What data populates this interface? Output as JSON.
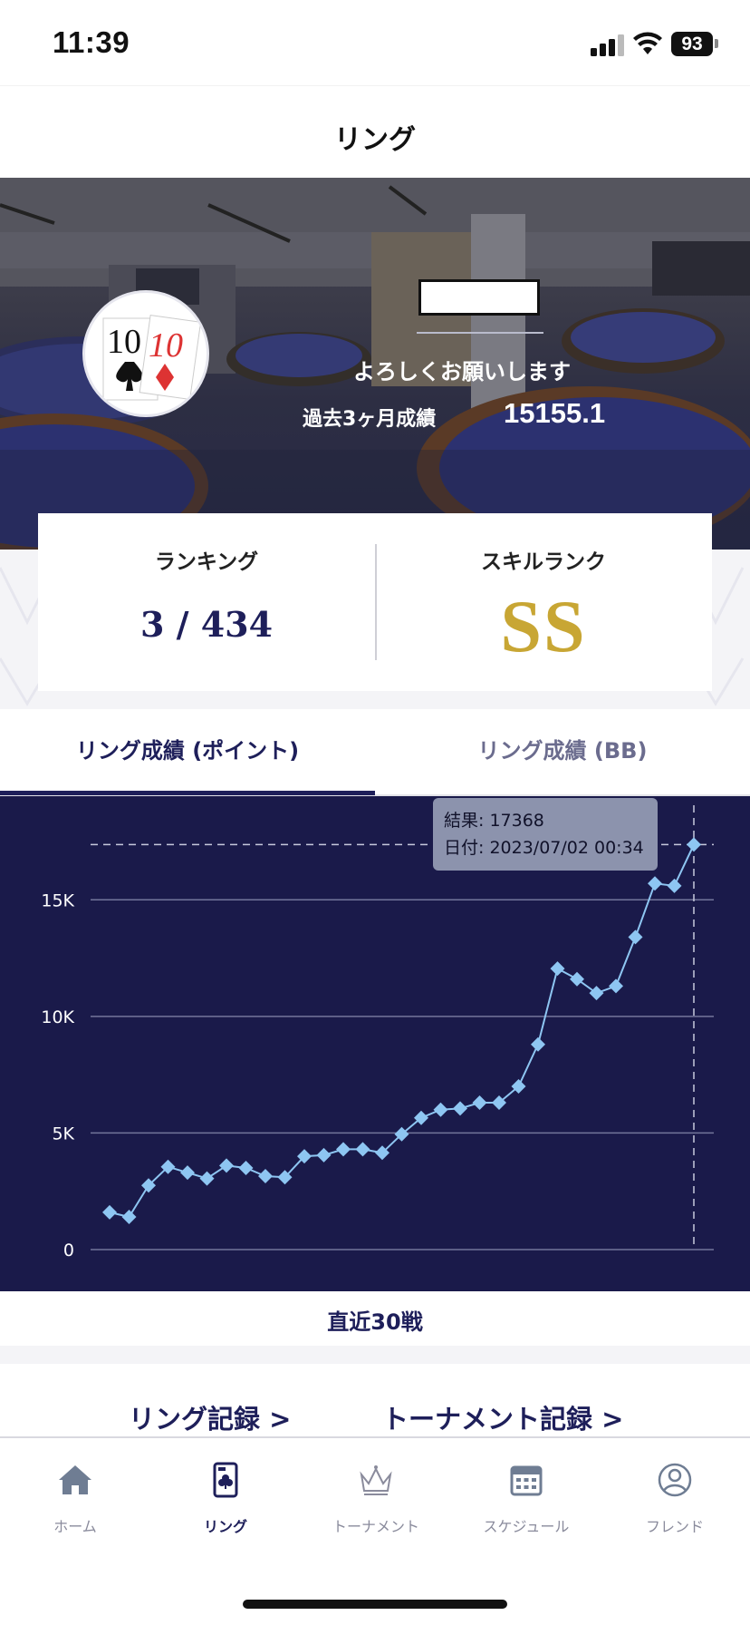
{
  "status_bar": {
    "time": "11:39",
    "battery": "93"
  },
  "header": {
    "title": "リング"
  },
  "profile": {
    "greeting": "よろしくお願いします",
    "record_label": "過去3ヶ月成績",
    "record_value": "15155.1"
  },
  "stats": {
    "ranking_label": "ランキング",
    "ranking_value": "3 / 434",
    "skill_label": "スキルランク",
    "skill_value": "SS"
  },
  "tabs": [
    {
      "label": "リング成績 (ポイント)",
      "active": true
    },
    {
      "label": "リング成績 (BB)",
      "active": false
    }
  ],
  "tooltip": {
    "result_label": "結果:",
    "result_value": "17368",
    "date_label": "日付:",
    "date_value": "2023/07/02 00:34"
  },
  "chart_data": {
    "type": "line",
    "y_ticks": [
      "0",
      "5K",
      "10K",
      "15K"
    ],
    "ylim": [
      0,
      17500
    ],
    "y_tick_values": [
      0,
      5000,
      10000,
      15000
    ],
    "x": [
      1,
      2,
      3,
      4,
      5,
      6,
      7,
      8,
      9,
      10,
      11,
      12,
      13,
      14,
      15,
      16,
      17,
      18,
      19,
      20,
      21,
      22,
      23,
      24,
      25,
      26,
      27,
      28,
      29,
      30
    ],
    "values": [
      1600,
      1400,
      2750,
      3550,
      3300,
      3050,
      3600,
      3500,
      3150,
      3100,
      4000,
      4050,
      4300,
      4300,
      4150,
      4950,
      5650,
      6000,
      6050,
      6300,
      6300,
      7000,
      8800,
      12050,
      11600,
      11000,
      11300,
      13400,
      15700,
      15600,
      17368
    ],
    "series": [
      {
        "values": [
          1600,
          1400,
          2750,
          3550,
          3300,
          3050,
          3600,
          3500,
          3150,
          3100,
          4000,
          4050,
          4300,
          4300,
          4150,
          4950,
          5650,
          6000,
          6050,
          6300,
          6300,
          7000,
          8800,
          12050,
          11600,
          11000,
          11300,
          13400,
          15700,
          15600,
          17368
        ]
      }
    ],
    "highlight_value": 17368,
    "line_color": "#8ec6f2",
    "background_color": "#1a1a4a"
  },
  "recent_label": "直近30戦",
  "links": {
    "ring_record": "リング記録 >",
    "tournament_record": "トーナメント記録 >"
  },
  "bottom_nav": [
    {
      "label": "ホーム",
      "icon": "home-icon",
      "active": false
    },
    {
      "label": "リング",
      "icon": "card-icon",
      "active": true
    },
    {
      "label": "トーナメント",
      "icon": "crown-icon",
      "active": false
    },
    {
      "label": "スケジュール",
      "icon": "calendar-icon",
      "active": false
    },
    {
      "label": "フレンド",
      "icon": "user-icon",
      "active": false
    }
  ],
  "colors": {
    "navy": "#1e1f5a",
    "gold": "#c8a634",
    "chart_bg": "#1a1a4a",
    "chart_line": "#8ec6f2"
  }
}
